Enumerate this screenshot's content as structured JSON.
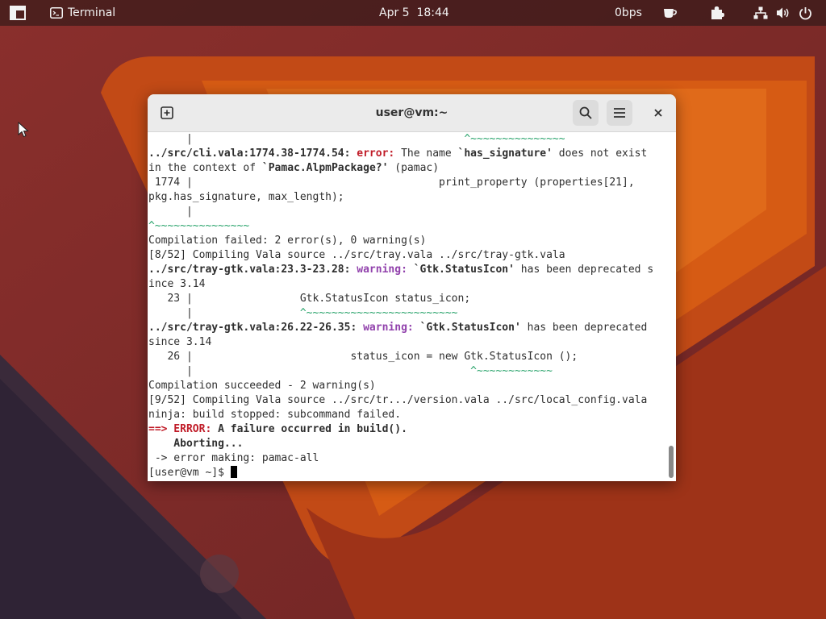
{
  "topbar": {
    "app_name": "Terminal",
    "clock": "Apr 5  18:44",
    "net_speed": "0bps"
  },
  "window": {
    "title": "user@vm:~"
  },
  "terminal": {
    "lines": [
      [
        {
          "t": "      |                                           "
        },
        {
          "t": "^~~~~~~~~~~~~~~~",
          "c": "grn"
        }
      ],
      [
        {
          "t": "../src/cli.vala:1774.38-1774.54: ",
          "c": "b"
        },
        {
          "t": "error:",
          "c": "err"
        },
        {
          "t": " The name "
        },
        {
          "t": "`has_signature'",
          "c": "b"
        },
        {
          "t": " does not exist"
        }
      ],
      [
        {
          "t": "in the context of "
        },
        {
          "t": "`Pamac.AlpmPackage?'",
          "c": "b"
        },
        {
          "t": " (pamac)"
        }
      ],
      [
        {
          "t": " 1774 |                                       print_property (properties[21],"
        }
      ],
      [
        {
          "t": "pkg.has_signature, max_length);"
        }
      ],
      [
        {
          "t": "      |"
        }
      ],
      [
        {
          "t": "^~~~~~~~~~~~~~~~",
          "c": "grn"
        }
      ],
      [
        {
          "t": "Compilation failed: 2 error(s), 0 warning(s)"
        }
      ],
      [
        {
          "t": "[8/52] Compiling Vala source ../src/tray.vala ../src/tray-gtk.vala"
        }
      ],
      [
        {
          "t": "../src/tray-gtk.vala:23.3-23.28: ",
          "c": "b"
        },
        {
          "t": "warning:",
          "c": "warn"
        },
        {
          "t": " "
        },
        {
          "t": "`Gtk.StatusIcon'",
          "c": "b"
        },
        {
          "t": " has been deprecated s"
        }
      ],
      [
        {
          "t": "ince 3.14"
        }
      ],
      [
        {
          "t": "   23 |                 Gtk.StatusIcon status_icon;"
        }
      ],
      [
        {
          "t": "      |                 "
        },
        {
          "t": "^~~~~~~~~~~~~~~~~~~~~~~~~",
          "c": "grn"
        }
      ],
      [
        {
          "t": "../src/tray-gtk.vala:26.22-26.35: ",
          "c": "b"
        },
        {
          "t": "warning:",
          "c": "warn"
        },
        {
          "t": " "
        },
        {
          "t": "`Gtk.StatusIcon'",
          "c": "b"
        },
        {
          "t": " has been deprecated"
        }
      ],
      [
        {
          "t": "since 3.14"
        }
      ],
      [
        {
          "t": "   26 |                         status_icon = new Gtk.StatusIcon ();"
        }
      ],
      [
        {
          "t": "      |                                            "
        },
        {
          "t": "^~~~~~~~~~~~~",
          "c": "grn"
        }
      ],
      [
        {
          "t": "Compilation succeeded - 2 warning(s)"
        }
      ],
      [
        {
          "t": "[9/52] Compiling Vala source ../src/tr.../version.vala ../src/local_config.vala"
        }
      ],
      [
        {
          "t": "ninja: build stopped: subcommand failed."
        }
      ],
      [
        {
          "t": "==> ERROR:",
          "c": "red"
        },
        {
          "t": " A failure occurred in build().",
          "c": "b"
        }
      ],
      [
        {
          "t": "    Aborting...",
          "c": "b"
        }
      ],
      [
        {
          "t": " -> error making: pamac-all"
        }
      ]
    ],
    "prompt": "[user@vm ~]$ "
  }
}
